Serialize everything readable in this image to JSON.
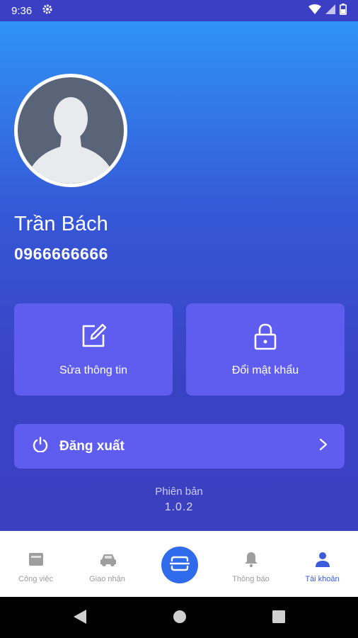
{
  "status_bar": {
    "time": "9:36",
    "icons": [
      "gear-icon",
      "wifi-icon",
      "signal-icon",
      "battery-icon"
    ]
  },
  "profile": {
    "name": "Trần Bách",
    "phone": "0966666666"
  },
  "actions": {
    "edit_info": {
      "label": "Sửa thông tin",
      "icon": "edit-icon"
    },
    "change_password": {
      "label": "Đổi mật khẩu",
      "icon": "lock-icon"
    }
  },
  "logout": {
    "label": "Đăng xuất",
    "icon": "power-icon"
  },
  "version": {
    "label": "Phiên bản",
    "value": "1.0.2"
  },
  "bottom_nav": {
    "items": [
      {
        "label": "Công việc",
        "icon": "tasks-icon",
        "active": false
      },
      {
        "label": "Giao nhận",
        "icon": "car-icon",
        "active": false
      },
      {
        "label": "",
        "icon": "scan-icon",
        "active": false
      },
      {
        "label": "Thông báo",
        "icon": "bell-icon",
        "active": false
      },
      {
        "label": "Tài khoản",
        "icon": "user-icon",
        "active": true
      }
    ]
  },
  "colors": {
    "accent": "#2f6bea",
    "card": "#5f5cf0",
    "active_nav": "#3b5bdb"
  }
}
